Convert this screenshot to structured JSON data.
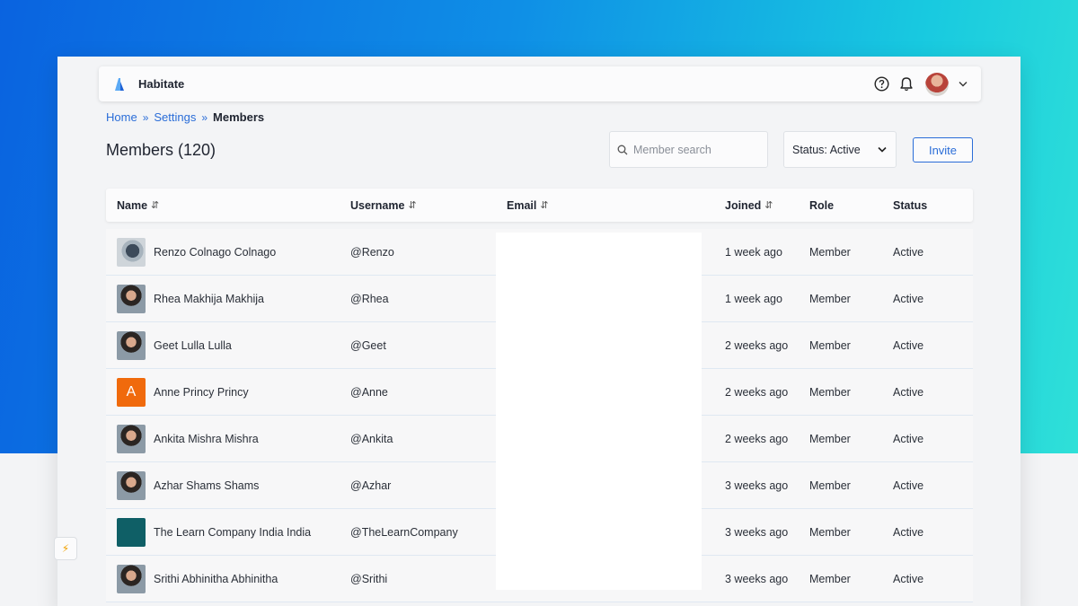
{
  "app": {
    "brand": "Habitate"
  },
  "breadcrumb": {
    "home": "Home",
    "settings": "Settings",
    "current": "Members",
    "sep": "»"
  },
  "page": {
    "title": "Members (120)"
  },
  "search": {
    "placeholder": "Member search",
    "value": ""
  },
  "filter": {
    "status_label": "Status: Active"
  },
  "actions": {
    "invite_label": "Invite"
  },
  "colors": {
    "accent": "#2a6dd8",
    "gradient_start": "#0a63e0",
    "gradient_end": "#2fe0d8"
  },
  "table": {
    "headers": {
      "name": "Name",
      "username": "Username",
      "email": "Email",
      "joined": "Joined",
      "role": "Role",
      "status": "Status"
    },
    "sort_glyph": "⇵",
    "rows": [
      {
        "name": "Renzo Colnago Colnago",
        "username": "@Renzo",
        "joined": "1 week ago",
        "role": "Member",
        "status": "Active",
        "avatar": "photo-camera"
      },
      {
        "name": "Rhea Makhija Makhija",
        "username": "@Rhea",
        "joined": "1 week ago",
        "role": "Member",
        "status": "Active",
        "avatar": "photo-person"
      },
      {
        "name": "Geet Lulla Lulla",
        "username": "@Geet",
        "joined": "2 weeks ago",
        "role": "Member",
        "status": "Active",
        "avatar": "photo-person"
      },
      {
        "name": "Anne Princy Princy",
        "username": "@Anne",
        "joined": "2 weeks ago",
        "role": "Member",
        "status": "Active",
        "avatar": "letter",
        "avatar_letter": "A"
      },
      {
        "name": "Ankita Mishra Mishra",
        "username": "@Ankita",
        "joined": "2 weeks ago",
        "role": "Member",
        "status": "Active",
        "avatar": "photo-person"
      },
      {
        "name": "Azhar Shams Shams",
        "username": "@Azhar",
        "joined": "3 weeks ago",
        "role": "Member",
        "status": "Active",
        "avatar": "photo-person"
      },
      {
        "name": "The Learn Company India India",
        "username": "@TheLearnCompany",
        "joined": "3 weeks ago",
        "role": "Member",
        "status": "Active",
        "avatar": "logo"
      },
      {
        "name": "Srithi Abhinitha Abhinitha",
        "username": "@Srithi",
        "joined": "3 weeks ago",
        "role": "Member",
        "status": "Active",
        "avatar": "photo-person"
      }
    ]
  },
  "side_flag": {
    "glyph": "⚡"
  }
}
